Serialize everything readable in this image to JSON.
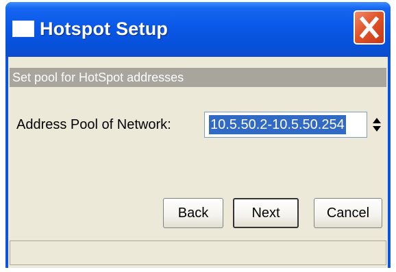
{
  "window": {
    "title": "Hotspot Setup"
  },
  "section": {
    "header": "Set pool for HotSpot addresses"
  },
  "form": {
    "label": "Address Pool of Network:",
    "value": "10.5.50.2-10.5.50.254"
  },
  "buttons": {
    "back": "Back",
    "next": "Next",
    "cancel": "Cancel"
  },
  "icons": {
    "window": "window-icon",
    "close": "close-icon",
    "spinner": "spinner-icon"
  },
  "colors": {
    "titlebar": "#0a58e8",
    "close": "#e0542a",
    "selection": "#316ac5",
    "dialog": "#ece9d8",
    "header": "#a7a59c"
  }
}
